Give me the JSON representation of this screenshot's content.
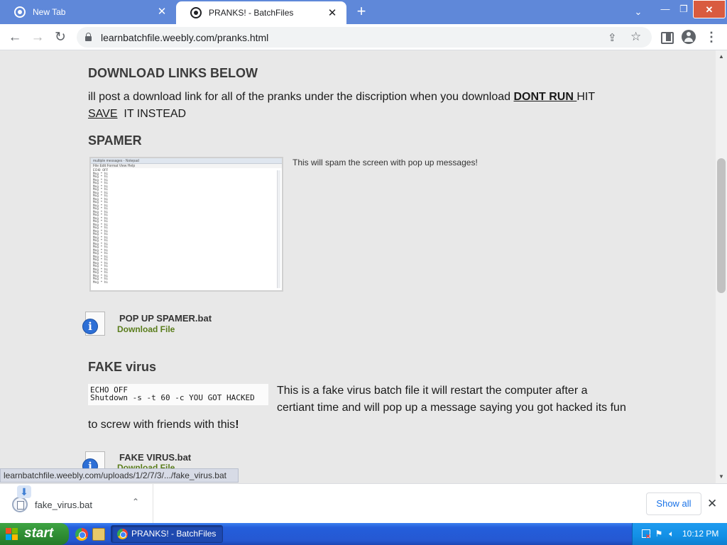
{
  "browser": {
    "tabs": [
      {
        "title": "New Tab",
        "active": false
      },
      {
        "title": "PRANKS! - BatchFiles",
        "active": true
      }
    ],
    "new_tab_label": "+",
    "url": "learnbatchfile.weebly.com/pranks.html"
  },
  "icons": {
    "close": "✕",
    "back": "←",
    "forward": "→",
    "reload": "↻",
    "share": "⇪",
    "star": "☆",
    "menu": "⋮",
    "chevron_down": "⌄",
    "chevron_up": "⌃",
    "minimize": "—",
    "maximize": "❐",
    "info": "i",
    "download_arrow": "⬇",
    "scroll_up": "▲",
    "scroll_down": "▼"
  },
  "page": {
    "heading_download": "DOWNLOAD LINKS BELOW",
    "intro": {
      "text1": "ill post a download link for all of the pranks under the discription when you download ",
      "dont_run": "DONT RUN ",
      "text2": "HIT",
      "save": "SAVE",
      "text3": "  IT INSTEAD"
    },
    "spamer": {
      "heading": "SPAMER",
      "screenshot_title": "multiple messages - Notepad",
      "screenshot_menu": "File  Edit  Format  View  Help",
      "screenshot_lines": "ECHO OFF\nMsg * hi\nMsg * hi\nMsg * hi\nMsg * hi\nMsg * hi\nMsg * hi\nMsg * hi\nMsg * hi\nMsg * hi\nMsg * hi\nMsg * hi\nMsg * hi\nMsg * hi\nMsg * hi\nMsg * hi\nMsg * hi\nMsg * hi\nMsg * hi\nMsg * hi\nMsg * hi\nMsg * hi\nMsg * hi\nMsg * hi\nMsg * hi\nMsg * hi\nMsg * hi\nMsg * hi\nMsg * hi\nMsg * hi\nMsg * hi\nMsg * hi\nMsg * hi\nMsg * hi\nMsg * hi\nMsg * hi",
      "caption": "This will spam the screen with pop up messages!",
      "file_name": "POP UP SPAMER.bat",
      "download_label": "Download File"
    },
    "fake_virus": {
      "heading": "FAKE virus",
      "code": "ECHO OFF\nShutdown -s -t 60 -c YOU GOT HACKED",
      "desc_line1": "This is a fake virus batch file it will restart the computer after a",
      "desc_line2": "certiant time and will pop up a message saying you got hacked its fun",
      "desc_line3": "to screw with friends with this",
      "desc_bang": "!",
      "file_name": "FAKE VIRUS.bat",
      "download_label": "Download File"
    }
  },
  "status_bar_url": "learnbatchfile.weebly.com/uploads/1/2/7/3/.../fake_virus.bat",
  "download_shelf": {
    "item_name": "fake_virus.bat",
    "show_all": "Show all"
  },
  "taskbar": {
    "start_label": "start",
    "window_button": "PRANKS! - BatchFiles -...",
    "clock": "10:12 PM"
  },
  "colors": {
    "tab_strip": "#5f88d9",
    "download_link": "#5a7d1c",
    "page_background": "#e8e8e8",
    "show_all_text": "#1a73e8"
  }
}
